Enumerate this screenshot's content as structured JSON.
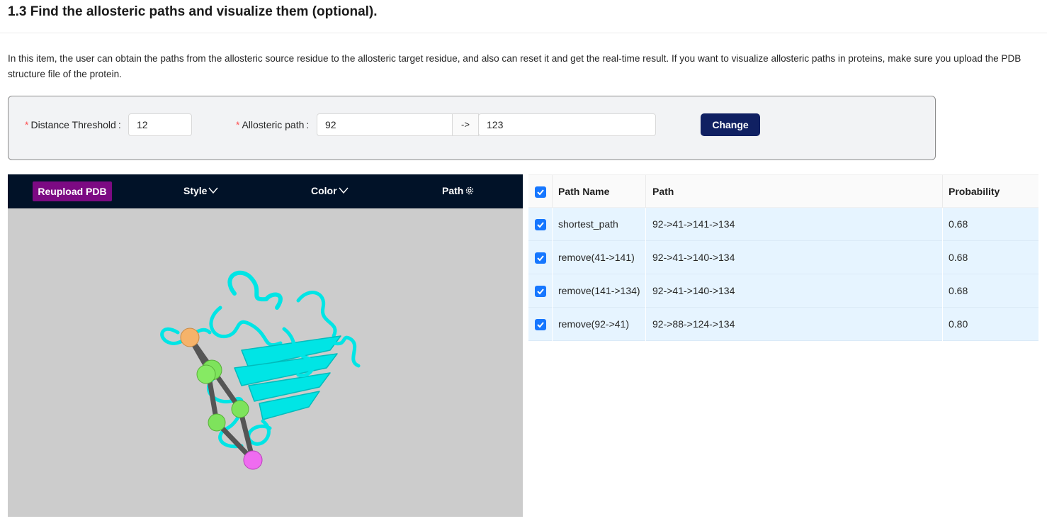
{
  "header": {
    "title": "1.3 Find the allosteric paths and visualize them (optional).",
    "description": "In this item, the user can obtain the paths from the allosteric source residue to the allosteric target residue, and also can reset it and get the real-time result. If you want to visualize allosteric paths in proteins, make sure you upload the PDB structure file of the protein."
  },
  "form": {
    "distance_label": "Distance Threshold",
    "distance_value": "12",
    "path_label": "Allosteric path",
    "source_value": "92",
    "arrow": "->",
    "target_value": "123",
    "change_label": "Change",
    "required_mark": "*",
    "colon": ":"
  },
  "viewer": {
    "reupload_label": "Reupload PDB",
    "style_label": "Style",
    "color_label": "Color",
    "path_label": "Path",
    "icons": [
      "chevron-down-icon",
      "chevron-down-icon",
      "gear-icon"
    ],
    "background_color": "#cccccc",
    "ribbon_color": "#00ffff",
    "sphere_colors": [
      "#f6b36a",
      "#7ee35c",
      "#ef6cf0"
    ]
  },
  "table": {
    "columns": [
      "Path Name",
      "Path",
      "Probability"
    ],
    "rows": [
      {
        "name": "shortest_path",
        "path": "92->41->141->134",
        "probability": "0.68"
      },
      {
        "name": "remove(41->141)",
        "path": "92->41->140->134",
        "probability": "0.68"
      },
      {
        "name": "remove(141->134)",
        "path": "92->41->140->134",
        "probability": "0.68"
      },
      {
        "name": "remove(92->41)",
        "path": "92->88->124->134",
        "probability": "0.80"
      }
    ],
    "all_checked": true,
    "accent_color": "#1677ff"
  }
}
